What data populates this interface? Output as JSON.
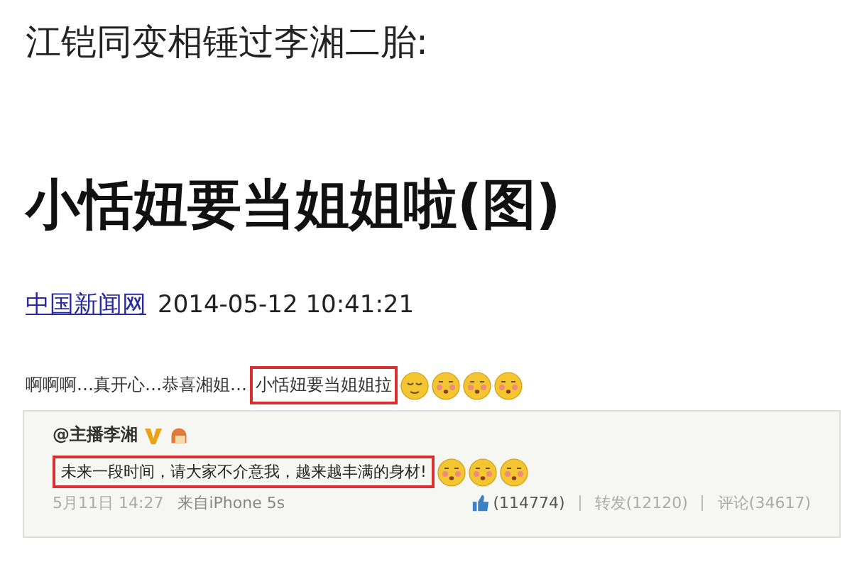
{
  "article": {
    "subtitle": "江铠同变相锤过李湘二胎:",
    "headline": "小恬妞要当姐姐啦(图)",
    "source": "中国新闻网",
    "datetime": "2014-05-12 10:41:21"
  },
  "post": {
    "segments": [
      {
        "text": "啊啊啊…真开心…恭喜湘姐…",
        "highlighted": false
      },
      {
        "text": "小恬妞要当姐姐拉",
        "highlighted": true
      }
    ],
    "emoticons": [
      {
        "kind": "content"
      },
      {
        "kind": "blush"
      },
      {
        "kind": "blush"
      },
      {
        "kind": "blush"
      }
    ],
    "quote": {
      "author": "@主播李湘",
      "verified": true,
      "segments": [
        {
          "text": "未来一段时间，请大家不介意我，越来越丰满的身材!",
          "highlighted": true
        }
      ],
      "emoticons": [
        {
          "kind": "blush"
        },
        {
          "kind": "blush"
        },
        {
          "kind": "blush"
        }
      ],
      "date": "5月11日  14:27",
      "via": "来自iPhone 5s",
      "likes": "(114774)",
      "reposts": "转发(12120)",
      "comments": "评论(34617)"
    }
  }
}
